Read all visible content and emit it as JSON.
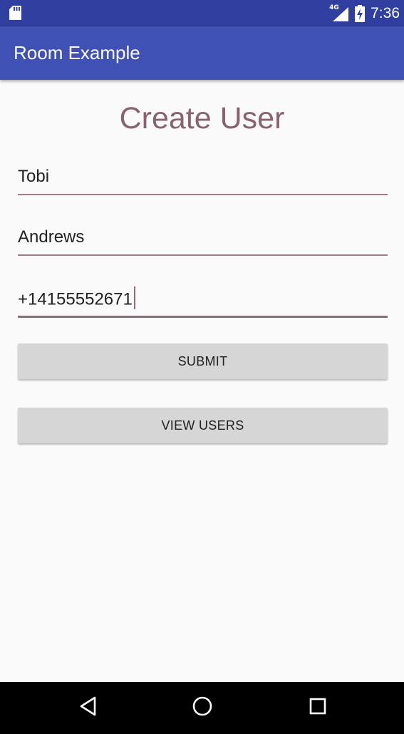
{
  "status_bar": {
    "network_type": "4G",
    "time": "7:36",
    "icons": [
      "sd-card-icon",
      "signal-icon",
      "battery-charging-icon"
    ]
  },
  "app_bar": {
    "title": "Room Example"
  },
  "form": {
    "heading": "Create User",
    "first_name_value": "Tobi",
    "last_name_value": "Andrews",
    "phone_value": "+14155552671",
    "submit_label": "SUBMIT",
    "view_users_label": "VIEW USERS"
  },
  "nav_bar": {
    "icons": [
      "back-icon",
      "home-icon",
      "recents-icon"
    ]
  },
  "colors": {
    "status_bar": "#303f9f",
    "app_bar": "#3f51b5",
    "heading": "#8a6170",
    "field_underline": "#9c7a8a",
    "button": "#d6d6d6",
    "background": "#fafafa"
  }
}
